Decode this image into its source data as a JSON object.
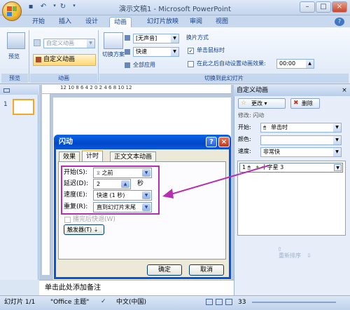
{
  "window": {
    "title": "演示文稿1 - Microsoft PowerPoint"
  },
  "tabs": [
    "开始",
    "插入",
    "设计",
    "动画",
    "幻灯片放映",
    "审阅",
    "视图"
  ],
  "active_tab": "动画",
  "ribbon": {
    "preview_label": "预览",
    "preview_group": "预览",
    "animate_label": "自定义动画",
    "custom_anim_button": "自定义动画",
    "anim_group": "动画",
    "transition_scheme_label": "切换方案",
    "sound_value": "[无声音]",
    "speed_value": "快速",
    "apply_all": "全部应用",
    "advance_label": "换片方式",
    "on_click": "单击鼠标时",
    "auto_after": "在此之后自动设置动画效果:",
    "auto_time": "00:00",
    "transition_group": "切换到此幻灯片"
  },
  "ruler": "12  10  8  6  4  2  0  2  4  6  8  10  12",
  "notes_placeholder": "单击此处添加备注",
  "slide_number": "1",
  "task_pane": {
    "title": "自定义动画",
    "change_button": "更改",
    "delete_button": "删除",
    "modify_label": "修改: 闪动",
    "start_label": "开始:",
    "start_value": "单击时",
    "color_label": "颜色:",
    "speed_label": "速度:",
    "speed_value": "非常快",
    "item_index": "1",
    "item_name": "十字星 3",
    "reorder_label": "重新排序"
  },
  "dialog": {
    "title": "闪动",
    "tabs": [
      "效果",
      "计时",
      "正文文本动画"
    ],
    "active_tab": "计时",
    "start_label": "开始(S):",
    "start_value": "之前",
    "delay_label": "延迟(D):",
    "delay_value": "2",
    "delay_unit": "秒",
    "speed_label": "速度(E):",
    "speed_value": "快速 (1 秒)",
    "repeat_label": "重复(R):",
    "repeat_value": "直到幻灯片末尾",
    "rewind_label": "播完后快退(W)",
    "trigger_button": "触发器(T)",
    "ok_button": "确定",
    "cancel_button": "取消"
  },
  "status": {
    "slide_info": "幻灯片 1/1",
    "theme": "\"Office 主题\"",
    "language": "中文(中国)",
    "zoom": "33"
  },
  "colors": {
    "accent": "#0054e3",
    "highlight": "#b72fb0",
    "ribbon_text": "#15428b"
  }
}
